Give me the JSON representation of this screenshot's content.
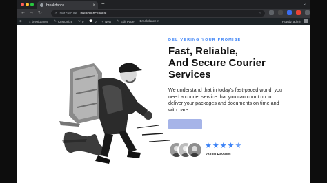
{
  "browser": {
    "tab_title": "breakdance",
    "tab_close": "×",
    "new_tab": "+",
    "nav_back": "←",
    "nav_forward": "→",
    "nav_reload": "↻",
    "security_label": "Not Secure",
    "url": "breakdance.local",
    "tabstrip_right": "⌄"
  },
  "admin_bar": {
    "items": [
      {
        "icon": "⊕",
        "label": ""
      },
      {
        "icon": "⌂",
        "label": "breakdance"
      },
      {
        "icon": "✎",
        "label": "Customize"
      },
      {
        "icon": "↻",
        "label": "0"
      },
      {
        "icon": "💬",
        "label": "0"
      },
      {
        "icon": "+",
        "label": "New"
      },
      {
        "icon": "✎",
        "label": "Edit Page"
      },
      {
        "icon": "",
        "label": "Breakdance ▾"
      }
    ],
    "greeting": "Howdy, admin"
  },
  "hero": {
    "eyebrow": "DELIVERING YOUR PROMISE",
    "headline_lines": [
      "Fast, Reliable,",
      "And Secure Courier",
      "Services"
    ],
    "description": "We understand that in today's fast-paced world, you need a courier service that you can count on to deliver your packages and documents on time and with care.",
    "rating": 4.5,
    "reviews_text": "28,000 Reviews",
    "stars": [
      "★",
      "★",
      "★",
      "★",
      "★"
    ]
  },
  "colors": {
    "accent": "#3b82f6",
    "button": "#a6b4e8",
    "adminbar": "#1d2327"
  }
}
